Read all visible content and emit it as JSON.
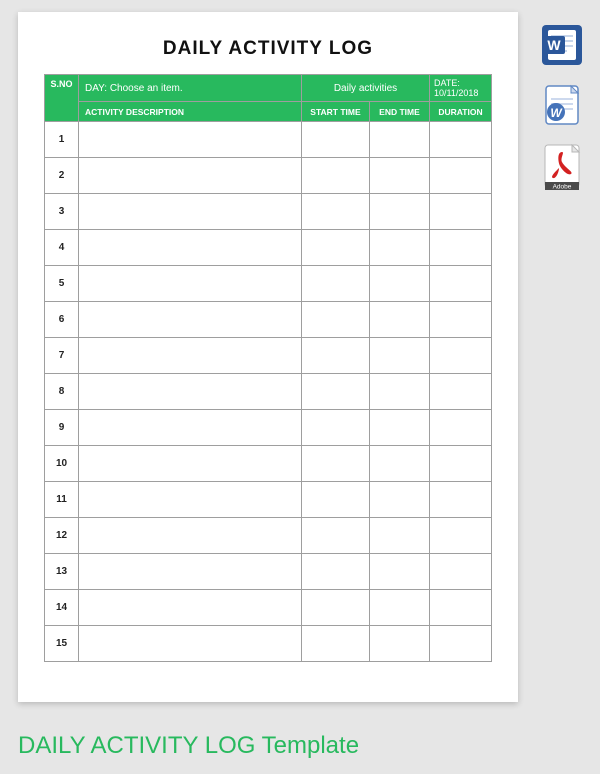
{
  "document": {
    "title": "DAILY ACTIVITY LOG",
    "header_row1": {
      "sno": "S.NO",
      "day_label": "DAY:  Choose an item.",
      "center_label": "Daily activities",
      "date_label": "DATE: 10/11/2018"
    },
    "header_row2": {
      "activity": "ACTIVITY DESCRIPTION",
      "start": "START TIME",
      "end": "END TIME",
      "duration": "DURATION"
    },
    "rows": [
      {
        "n": "1",
        "desc": "",
        "start": "",
        "end": "",
        "dur": ""
      },
      {
        "n": "2",
        "desc": "",
        "start": "",
        "end": "",
        "dur": ""
      },
      {
        "n": "3",
        "desc": "",
        "start": "",
        "end": "",
        "dur": ""
      },
      {
        "n": "4",
        "desc": "",
        "start": "",
        "end": "",
        "dur": ""
      },
      {
        "n": "5",
        "desc": "",
        "start": "",
        "end": "",
        "dur": ""
      },
      {
        "n": "6",
        "desc": "",
        "start": "",
        "end": "",
        "dur": ""
      },
      {
        "n": "7",
        "desc": "",
        "start": "",
        "end": "",
        "dur": ""
      },
      {
        "n": "8",
        "desc": "",
        "start": "",
        "end": "",
        "dur": ""
      },
      {
        "n": "9",
        "desc": "",
        "start": "",
        "end": "",
        "dur": ""
      },
      {
        "n": "10",
        "desc": "",
        "start": "",
        "end": "",
        "dur": ""
      },
      {
        "n": "11",
        "desc": "",
        "start": "",
        "end": "",
        "dur": ""
      },
      {
        "n": "12",
        "desc": "",
        "start": "",
        "end": "",
        "dur": ""
      },
      {
        "n": "13",
        "desc": "",
        "start": "",
        "end": "",
        "dur": ""
      },
      {
        "n": "14",
        "desc": "",
        "start": "",
        "end": "",
        "dur": ""
      },
      {
        "n": "15",
        "desc": "",
        "start": "",
        "end": "",
        "dur": ""
      }
    ]
  },
  "footer_caption": "DAILY ACTIVITY LOG Template",
  "download_icons": {
    "word": "W",
    "word_alt": "W",
    "pdf_brand": "Adobe"
  }
}
